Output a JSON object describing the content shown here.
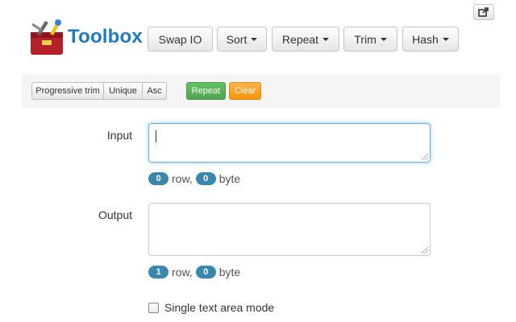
{
  "header": {
    "brand": "Toolbox",
    "share_icon": "share-icon",
    "buttons": [
      {
        "label": "Swap IO",
        "dropdown": false
      },
      {
        "label": "Sort",
        "dropdown": true
      },
      {
        "label": "Repeat",
        "dropdown": true
      },
      {
        "label": "Trim",
        "dropdown": true
      },
      {
        "label": "Hash",
        "dropdown": true
      }
    ]
  },
  "toolbar": {
    "group": [
      "Progressive trim",
      "Unique",
      "Asc"
    ],
    "repeat_label": "Repeat",
    "clear_label": "Clear"
  },
  "form": {
    "input_label": "Input",
    "output_label": "Output",
    "input_value": "",
    "output_value": "",
    "input_stats": {
      "rows": "0",
      "row_label": "row,",
      "bytes": "0",
      "byte_label": "byte"
    },
    "output_stats": {
      "rows": "1",
      "row_label": "row,",
      "bytes": "0",
      "byte_label": "byte"
    },
    "single_mode_label": "Single text area mode",
    "single_mode_checked": false
  },
  "colors": {
    "brand": "#1d7bc4",
    "badge": "#3a87ad",
    "repeat": "#5bb75b",
    "clear": "#f89406",
    "focus": "#66afe9"
  }
}
